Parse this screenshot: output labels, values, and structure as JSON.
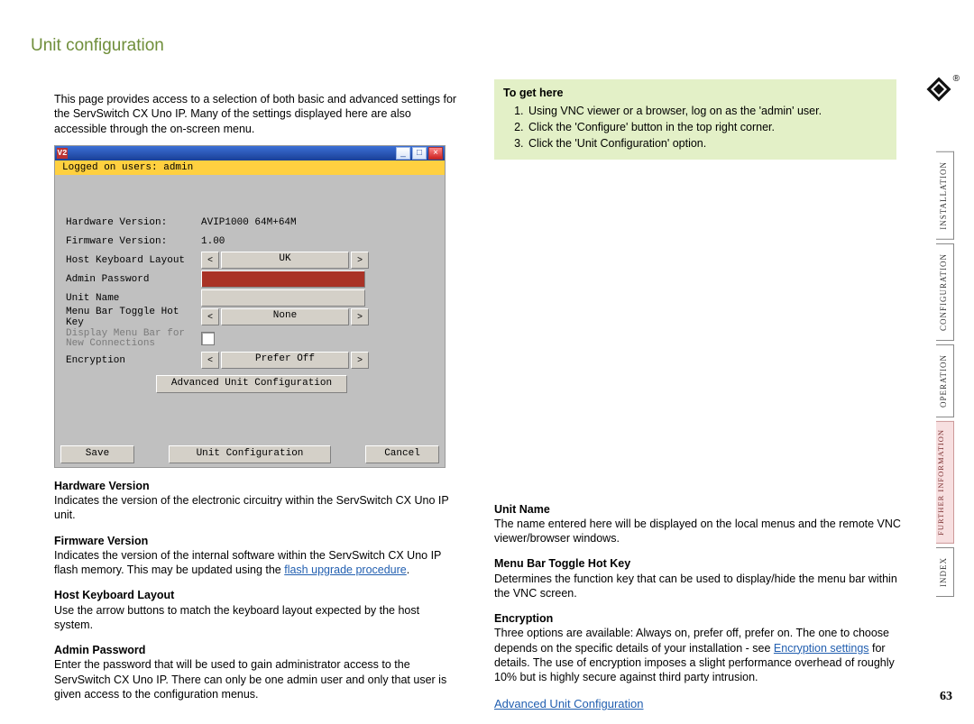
{
  "title": "Unit configuration",
  "intro": "This page provides access to a selection of both basic and advanced settings for the ServSwitch CX Uno IP. Many of the settings displayed here are also accessible through the on-screen menu.",
  "help": {
    "title": "To get here",
    "steps": [
      "Using VNC viewer or a browser, log on as the 'admin' user.",
      "Click the 'Configure' button in the top right corner.",
      "Click the 'Unit Configuration' option."
    ]
  },
  "vnc": {
    "icon": "V2",
    "logged": "Logged on users: admin",
    "rows": {
      "hw_lbl": "Hardware Version:",
      "hw_val": "AVIP1000 64M+64M",
      "fw_lbl": "Firmware Version:",
      "fw_val": "1.00",
      "kb_lbl": "Host Keyboard Layout",
      "kb_val": "UK",
      "pw_lbl": "Admin Password",
      "un_lbl": "Unit Name",
      "hk_lbl": "Menu Bar Toggle Hot Key",
      "hk_val": "None",
      "disp_lbl": "Display Menu Bar for New Connections",
      "enc_lbl": "Encryption",
      "enc_val": "Prefer Off",
      "adv_btn": "Advanced Unit Configuration"
    },
    "save": "Save",
    "center": "Unit Configuration",
    "cancel": "Cancel"
  },
  "sections_left": [
    {
      "h": "Hardware Version",
      "b": "Indicates the version of the electronic circuitry within the ServSwitch CX Uno IP unit."
    },
    {
      "h": "Firmware Version",
      "b": "Indicates the version of the internal software within the ServSwitch CX Uno IP flash memory. This may be updated using the ",
      "link": "flash upgrade procedure",
      "b2": "."
    },
    {
      "h": "Host Keyboard Layout",
      "b": "Use the arrow buttons to match the keyboard layout expected by the host system."
    },
    {
      "h": "Admin Password",
      "b": "Enter the password that will be used to gain administrator access to the ServSwitch CX Uno IP. There can only be one admin user and only that user is given access to the configuration menus."
    }
  ],
  "sections_right": [
    {
      "h": "Unit Name",
      "b": "The name entered here will be displayed on the local menus and the remote VNC viewer/browser windows."
    },
    {
      "h": "Menu Bar Toggle Hot Key",
      "b": "Determines the function key that can be used to display/hide the menu bar within the VNC screen."
    },
    {
      "h": "Encryption",
      "b": "Three options are available: Always on, prefer off, prefer on. The one to choose depends on the specific details of your installation - see ",
      "link": "Encryption settings",
      "b2": " for details. The use of encryption imposes a slight performance overhead of roughly 10% but is highly secure against third party intrusion."
    }
  ],
  "adv_link": "Advanced Unit Configuration",
  "tabs": [
    "INSTALLATION",
    "CONFIGURATION",
    "OPERATION",
    "FURTHER INFORMATION",
    "INDEX"
  ],
  "page_num": "63",
  "reg": "®"
}
